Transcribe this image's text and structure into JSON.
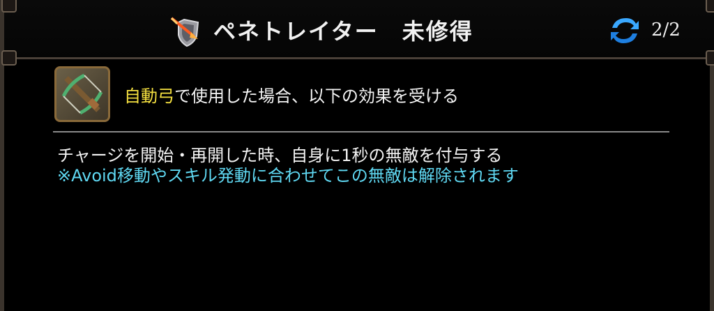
{
  "header": {
    "title": "ペネトレイター　未修得",
    "skill_type_icon": "shield-arrow-icon",
    "swap_icon": "swap-arrows-icon",
    "page_indicator": "2/2"
  },
  "condition": {
    "weapon_icon": "crossbow-icon",
    "weapon_name": "自動弓",
    "rest_text": "で使用した場合、以下の効果を受ける"
  },
  "effect": {
    "description": "チャージを開始・再開した時、自身に1秒の無敵を付与する",
    "note": "※Avoid移動やスキル発動に合わせてこの無敵は解除されます"
  },
  "colors": {
    "weapon_highlight": "#f5e040",
    "note_text": "#5fd8f2",
    "frame": "#3a332c"
  }
}
